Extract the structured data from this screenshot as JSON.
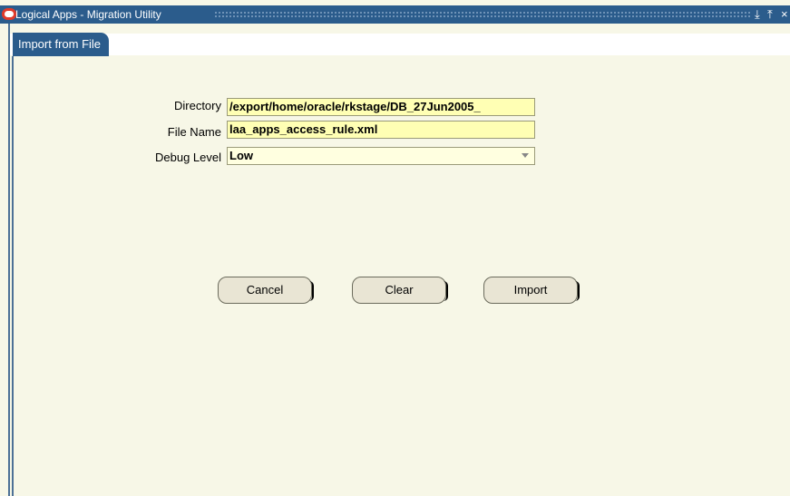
{
  "window": {
    "title": "Logical Apps - Migration Utility",
    "controls": [
      "⤓",
      "⤒",
      "×"
    ]
  },
  "tab": {
    "label": "Import from File"
  },
  "form": {
    "directory": {
      "label": "Directory",
      "value": "/export/home/oracle/rkstage/DB_27Jun2005_"
    },
    "file_name": {
      "label": "File Name",
      "value": "laa_apps_access_rule.xml"
    },
    "debug_level": {
      "label": "Debug Level",
      "value": "Low"
    }
  },
  "buttons": {
    "cancel": "Cancel",
    "clear": "Clear",
    "import": "Import"
  },
  "colors": {
    "title_bar": "#2b5c8c",
    "field_bg": "#ffffb4",
    "window_bg": "#f7f7e7"
  }
}
